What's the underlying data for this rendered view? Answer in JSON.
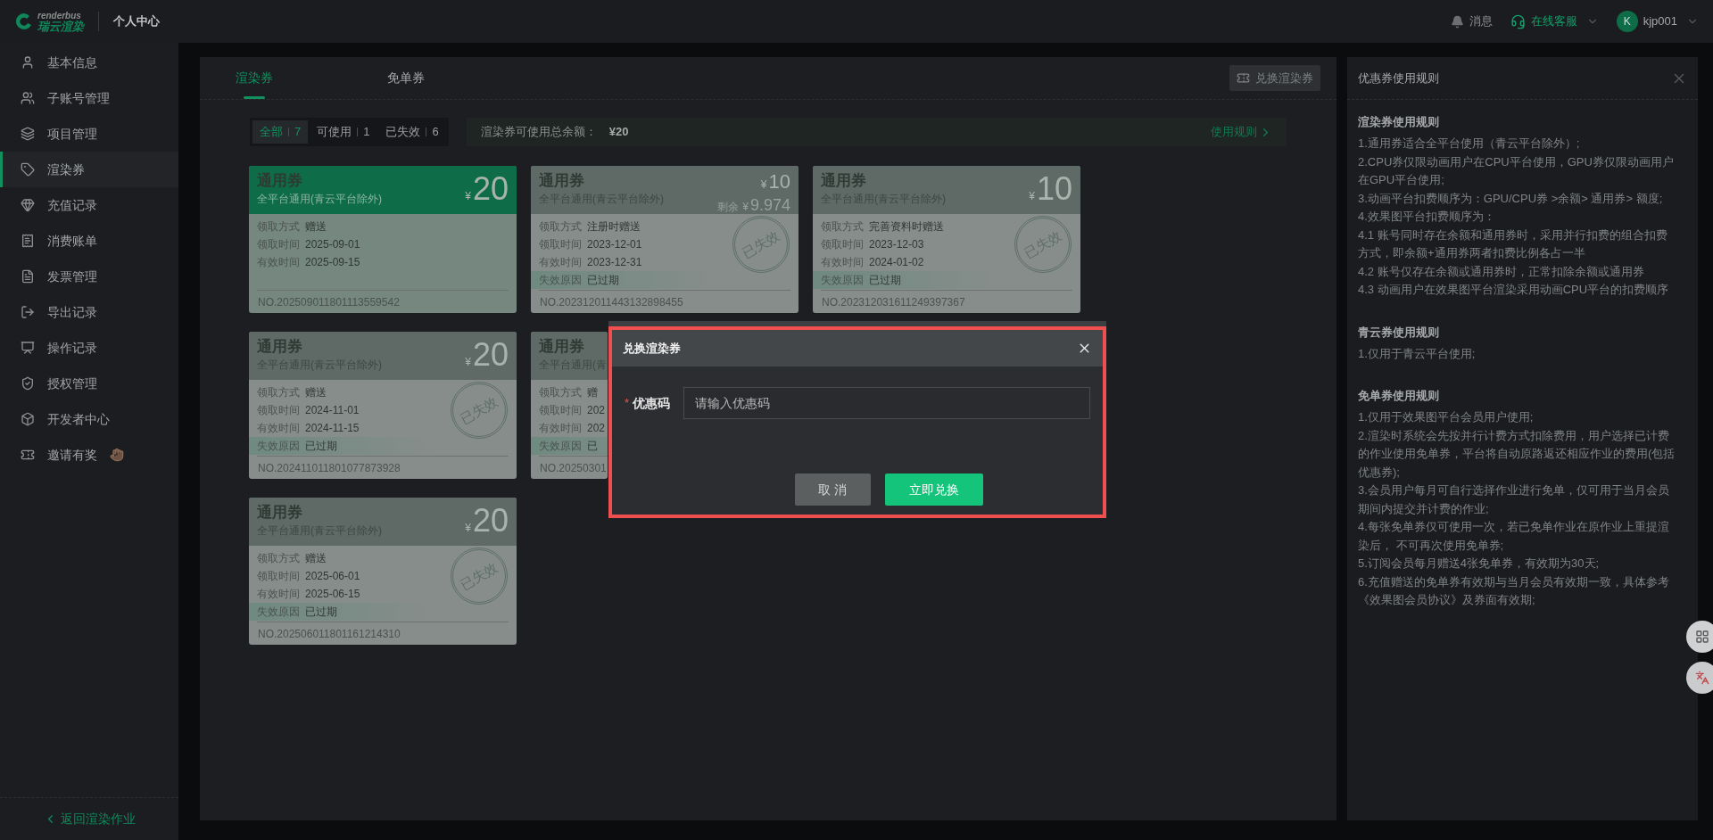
{
  "header": {
    "brand_top": "renderbus",
    "brand_name": "瑞云渲染",
    "section": "个人中心",
    "messages": "消息",
    "support": "在线客服",
    "avatar": "K",
    "username": "kjp001"
  },
  "sidebar": {
    "items": [
      {
        "label": "基本信息",
        "selected": false
      },
      {
        "label": "子账号管理",
        "selected": false
      },
      {
        "label": "项目管理",
        "selected": false
      },
      {
        "label": "渲染券",
        "selected": true
      },
      {
        "label": "充值记录",
        "selected": false
      },
      {
        "label": "消费账单",
        "selected": false
      },
      {
        "label": "发票管理",
        "selected": false
      },
      {
        "label": "导出记录",
        "selected": false
      },
      {
        "label": "操作记录",
        "selected": false
      },
      {
        "label": "授权管理",
        "selected": false
      },
      {
        "label": "开发者中心",
        "selected": false
      },
      {
        "label": "邀请有奖",
        "selected": false
      }
    ],
    "back_link": "返回渲染作业"
  },
  "tabs": [
    {
      "label": "渲染券",
      "selected": true
    },
    {
      "label": "免单券",
      "selected": false
    }
  ],
  "exchange_button": "兑换渲染券",
  "filters": [
    {
      "label": "全部",
      "count": "7",
      "selected": true
    },
    {
      "label": "可使用",
      "count": "1",
      "selected": false
    },
    {
      "label": "已失效",
      "count": "6",
      "selected": false
    }
  ],
  "balance": {
    "label": "渲染券可使用总余额：",
    "value": "¥20",
    "rules_link": "使用规则"
  },
  "coupons": [
    {
      "kind": "available",
      "title": "通用券",
      "subtitle": "全平台通用(青云平台除外)",
      "currency": "¥",
      "amount": "20",
      "fields": [
        {
          "label": "领取方式",
          "value": "赠送"
        },
        {
          "label": "领取时间",
          "value": "2025-09-01"
        },
        {
          "label": "有效时间",
          "value": "2025-09-15"
        }
      ],
      "number": "NO.202509011801113559542"
    },
    {
      "kind": "expired",
      "title": "通用券",
      "subtitle": "全平台通用(青云平台除外)",
      "currency": "¥",
      "amount": "10",
      "remaining_label": "剩余",
      "remaining": "9.974",
      "fields": [
        {
          "label": "领取方式",
          "value": "注册时赠送"
        },
        {
          "label": "领取时间",
          "value": "2023-12-01"
        },
        {
          "label": "有效时间",
          "value": "2023-12-31"
        }
      ],
      "reason": {
        "label": "失效原因",
        "value": "已过期"
      },
      "stamp": "已失效",
      "number": "NO.202312011443132898455"
    },
    {
      "kind": "expired",
      "title": "通用券",
      "subtitle": "全平台通用(青云平台除外)",
      "currency": "¥",
      "amount": "10",
      "fields": [
        {
          "label": "领取方式",
          "value": "完善资料时赠送"
        },
        {
          "label": "领取时间",
          "value": "2023-12-03"
        },
        {
          "label": "有效时间",
          "value": "2024-01-02"
        }
      ],
      "reason": {
        "label": "失效原因",
        "value": "已过期"
      },
      "stamp": "已失效",
      "number": "NO.202312031611249397367"
    },
    {
      "kind": "expired",
      "title": "通用券",
      "subtitle": "全平台通用(青云平台除外)",
      "currency": "¥",
      "amount": "20",
      "fields": [
        {
          "label": "领取方式",
          "value": "赠送"
        },
        {
          "label": "领取时间",
          "value": "2024-11-01"
        },
        {
          "label": "有效时间",
          "value": "2024-11-15"
        }
      ],
      "reason": {
        "label": "失效原因",
        "value": "已过期"
      },
      "stamp": "已失效",
      "number": "NO.202411011801077873928"
    },
    {
      "kind": "expired",
      "covered": true,
      "title": "通用券",
      "subtitle": "全平台通用(青",
      "fields": [
        {
          "label": "领取方式",
          "value": "赠"
        },
        {
          "label": "领取时间",
          "value": "202"
        },
        {
          "label": "有效时间",
          "value": "202"
        }
      ],
      "reason": {
        "label": "失效原因",
        "value": "已"
      },
      "number": "NO.20250301"
    },
    {
      "kind": "expired",
      "title": "通用券",
      "subtitle": "全平台通用(青云平台除外)",
      "currency": "¥",
      "amount": "20",
      "fields": [
        {
          "label": "领取方式",
          "value": "赠送"
        },
        {
          "label": "领取时间",
          "value": "2025-06-01"
        },
        {
          "label": "有效时间",
          "value": "2025-06-15"
        }
      ],
      "reason": {
        "label": "失效原因",
        "value": "已过期"
      },
      "stamp": "已失效",
      "number": "NO.202506011801161214310"
    }
  ],
  "dialog": {
    "title": "兑换渲染券",
    "field_label": "优惠码",
    "required_mark": "*",
    "placeholder": "请输入优惠码",
    "cancel": "取 消",
    "confirm": "立即兑换"
  },
  "rules_panel": {
    "title": "优惠券使用规则",
    "sections": [
      {
        "heading": "渲染券使用规则",
        "items": [
          "1.通用券适合全平台使用（青云平台除外）;",
          "2.CPU券仅限动画用户在CPU平台使用，GPU券仅限动画用户在GPU平台使用;",
          "3.动画平台扣费顺序为：GPU/CPU券 >余额> 通用券> 额度;",
          "4.效果图平台扣费顺序为：",
          "4.1 账号同时存在余额和通用券时，采用并行扣费的组合扣费方式，即余额+通用券两者扣费比例各占一半",
          "4.2 账号仅存在余额或通用券时，正常扣除余额或通用券",
          "4.3 动画用户在效果图平台渲染采用动画CPU平台的扣费顺序"
        ]
      },
      {
        "heading": "青云券使用规则",
        "items": [
          "1.仅用于青云平台使用;"
        ]
      },
      {
        "heading": "免单券使用规则",
        "items": [
          "1.仅用于效果图平台会员用户使用;",
          "2.渲染时系统会先按并行计费方式扣除费用，用户选择已计费的作业使用免单券，平台将自动原路返还相应作业的费用(包括优惠券);",
          "3.会员用户每月可自行选择作业进行免单，仅可用于当月会员期间内提交并计费的作业;",
          "4.每张免单券仅可使用一次，若已免单作业在原作业上重提渲染后， 不可再次使用免单券;",
          "5.订阅会员每月赠送4张免单券，有效期为30天;",
          "6.充值赠送的免单券有效期与当月会员有效期一致，具体参考《效果图会员协议》及券面有效期;"
        ]
      }
    ]
  }
}
